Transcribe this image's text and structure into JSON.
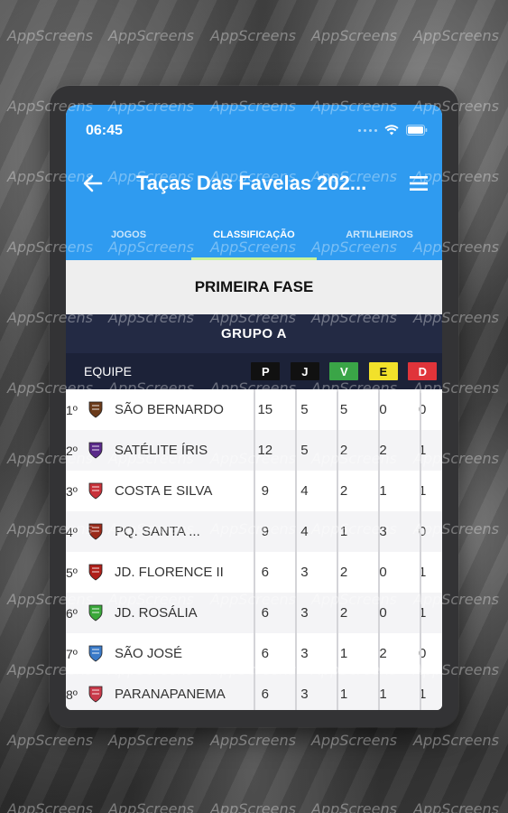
{
  "status_bar": {
    "time": "06:45"
  },
  "app_bar": {
    "title": "Taças Das Favelas 202..."
  },
  "tabs": [
    {
      "label": "JOGOS",
      "active": false
    },
    {
      "label": "CLASSIFICAÇÃO",
      "active": true
    },
    {
      "label": "ARTILHEIROS",
      "active": false
    }
  ],
  "phase_title": "PRIMEIRA FASE",
  "group_title": "GRUPO A",
  "table": {
    "team_header": "EQUIPE",
    "columns": [
      {
        "label": "P",
        "bg": "#111111",
        "fg": "#ffffff"
      },
      {
        "label": "J",
        "bg": "#111111",
        "fg": "#ffffff"
      },
      {
        "label": "V",
        "bg": "#3aa547",
        "fg": "#ffffff"
      },
      {
        "label": "E",
        "bg": "#f2e12a",
        "fg": "#111111"
      },
      {
        "label": "D",
        "bg": "#e0343a",
        "fg": "#ffffff"
      }
    ],
    "rows": [
      {
        "pos": "1º",
        "team": "SÃO BERNARDO",
        "crest": "#6b3b1a",
        "p": "15",
        "j": "5",
        "v": "5",
        "e": "0",
        "d": "0"
      },
      {
        "pos": "2º",
        "team": "SATÉLITE ÍRIS",
        "crest": "#5a2a8a",
        "p": "12",
        "j": "5",
        "v": "2",
        "e": "2",
        "d": "1"
      },
      {
        "pos": "3º",
        "team": "COSTA E SILVA",
        "crest": "#c8323a",
        "p": "9",
        "j": "4",
        "v": "2",
        "e": "1",
        "d": "1"
      },
      {
        "pos": "4º",
        "team": "PQ. SANTA ...",
        "crest": "#9a2a1a",
        "p": "9",
        "j": "4",
        "v": "1",
        "e": "3",
        "d": "0"
      },
      {
        "pos": "5º",
        "team": "JD. FLORENCE II",
        "crest": "#b0201a",
        "p": "6",
        "j": "3",
        "v": "2",
        "e": "0",
        "d": "1"
      },
      {
        "pos": "6º",
        "team": "JD. ROSÁLIA",
        "crest": "#3aa83a",
        "p": "6",
        "j": "3",
        "v": "2",
        "e": "0",
        "d": "1"
      },
      {
        "pos": "7º",
        "team": "SÃO JOSÉ",
        "crest": "#3a7ac8",
        "p": "6",
        "j": "3",
        "v": "1",
        "e": "2",
        "d": "0"
      },
      {
        "pos": "8º",
        "team": "PARANAPANEMA",
        "crest": "#c83a4a",
        "p": "6",
        "j": "3",
        "v": "1",
        "e": "1",
        "d": "1"
      }
    ]
  },
  "watermark": "AppScreens",
  "colors": {
    "accent": "#2f9bf0",
    "tab_indicator": "#c8f29a",
    "header_dark": "#232a44"
  }
}
